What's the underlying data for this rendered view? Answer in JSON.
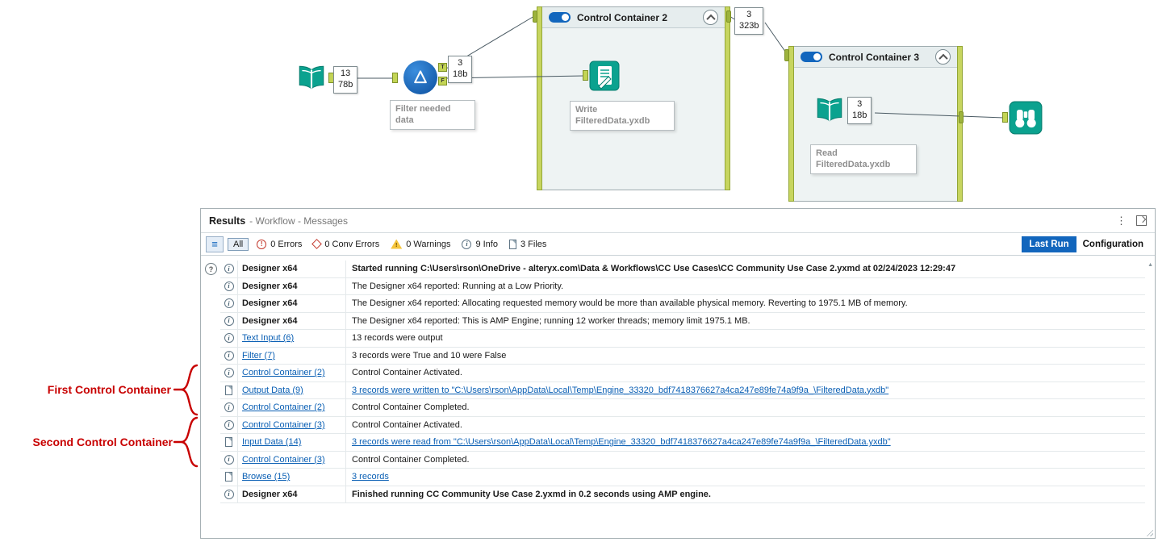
{
  "icons": {
    "kebab": "⋮",
    "list": "≡",
    "scroll_up": "▲",
    "help": "?"
  },
  "canvas": {
    "text_input_badge": {
      "l1": "13",
      "l2": "78b"
    },
    "filter": {
      "badge_l1": "3",
      "badge_l2": "18b",
      "annotation": "Filter needed\ndata",
      "port_true": "T",
      "port_false": "F"
    },
    "container2": {
      "title": "Control Container 2",
      "out_badge_l1": "3",
      "out_badge_l2": "323b"
    },
    "write_annotation": "Write\nFilteredData.yxdb",
    "container3": {
      "title": "Control Container 3"
    },
    "read_badge": {
      "l1": "3",
      "l2": "18b"
    },
    "read_annotation": "Read\nFilteredData.yxdb"
  },
  "results": {
    "title": "Results",
    "subtitle": "- Workflow - Messages",
    "toolbar": {
      "all_label": "All",
      "errors_label": "0 Errors",
      "conv_errors_label": "0 Conv Errors",
      "warnings_label": "0 Warnings",
      "info_label": "9 Info",
      "files_label": "3 Files",
      "last_run_label": "Last Run",
      "configuration_label": "Configuration"
    },
    "rows": [
      {
        "icon": "info",
        "tool": "Designer x64",
        "tool_style": "bold",
        "msg": "Started running C:\\Users\\rson\\OneDrive - alteryx.com\\Data & Workflows\\CC Use Cases\\CC Community Use Case 2.yxmd at 02/24/2023 12:29:47",
        "msg_style": "bold"
      },
      {
        "icon": "info",
        "tool": "Designer x64",
        "tool_style": "bold",
        "msg": "The Designer x64 reported: Running at a Low Priority.",
        "msg_style": "normal"
      },
      {
        "icon": "info",
        "tool": "Designer x64",
        "tool_style": "bold",
        "msg": "The Designer x64 reported: Allocating requested memory would be more than available physical memory. Reverting to 1975.1 MB of memory.",
        "msg_style": "normal"
      },
      {
        "icon": "info",
        "tool": "Designer x64",
        "tool_style": "bold",
        "msg": "The Designer x64 reported: This is AMP Engine; running 12 worker threads; memory limit 1975.1 MB.",
        "msg_style": "normal"
      },
      {
        "icon": "info",
        "tool": "Text Input (6)",
        "tool_style": "link",
        "msg": "13 records were output",
        "msg_style": "normal"
      },
      {
        "icon": "info",
        "tool": "Filter (7)",
        "tool_style": "link",
        "msg": "3 records were True and 10 were False",
        "msg_style": "normal"
      },
      {
        "icon": "info",
        "tool": "Control Container (2)",
        "tool_style": "link",
        "msg": "Control Container Activated.",
        "msg_style": "normal"
      },
      {
        "icon": "file",
        "tool": "Output Data (9)",
        "tool_style": "link",
        "msg": "3 records were written to \"C:\\Users\\rson\\AppData\\Local\\Temp\\Engine_33320_bdf7418376627a4ca247e89fe74a9f9a_\\FilteredData.yxdb\"",
        "msg_style": "link"
      },
      {
        "icon": "info",
        "tool": "Control Container (2)",
        "tool_style": "link",
        "msg": "Control Container Completed.",
        "msg_style": "normal"
      },
      {
        "icon": "info",
        "tool": "Control Container (3)",
        "tool_style": "link",
        "msg": "Control Container Activated.",
        "msg_style": "normal"
      },
      {
        "icon": "file",
        "tool": "Input Data (14)",
        "tool_style": "link",
        "msg": "3 records were read from \"C:\\Users\\rson\\AppData\\Local\\Temp\\Engine_33320_bdf7418376627a4ca247e89fe74a9f9a_\\FilteredData.yxdb\"",
        "msg_style": "link"
      },
      {
        "icon": "info",
        "tool": "Control Container (3)",
        "tool_style": "link",
        "msg": "Control Container Completed.",
        "msg_style": "normal"
      },
      {
        "icon": "file",
        "tool": "Browse (15)",
        "tool_style": "link",
        "msg": "3 records",
        "msg_style": "link"
      },
      {
        "icon": "info",
        "tool": "Designer x64",
        "tool_style": "bold",
        "msg": "Finished running CC Community Use Case 2.yxmd in 0.2 seconds using AMP engine.",
        "msg_style": "bold"
      }
    ]
  },
  "annotations": {
    "first_label": "First Control Container",
    "second_label": "Second Control Container",
    "color": "#c80000"
  },
  "colors": {
    "accent_teal": "#0ba28f",
    "link_blue": "#0a5fb4",
    "last_run_bg": "#1266bd"
  }
}
